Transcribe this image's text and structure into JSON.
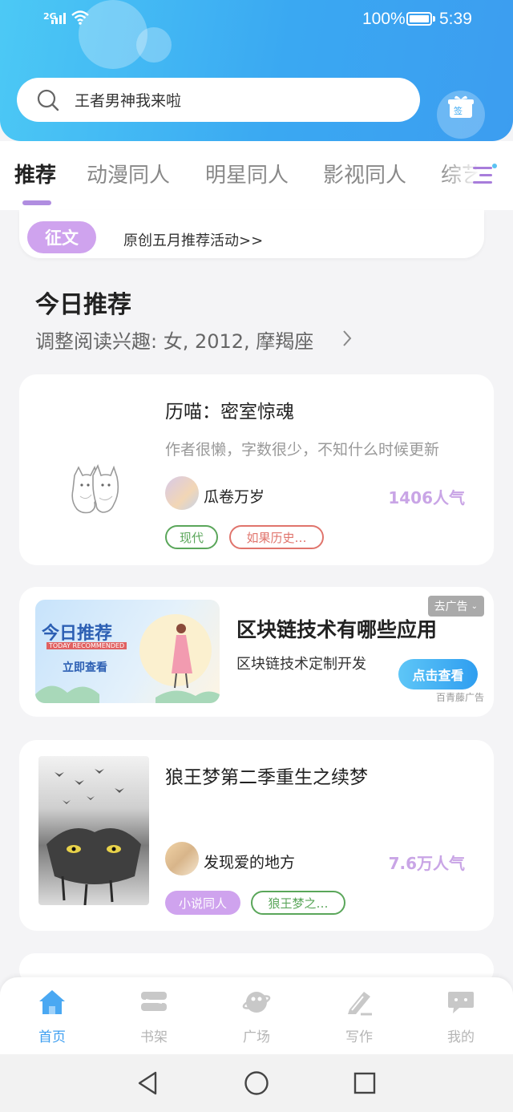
{
  "status_bar": {
    "signal": "2G",
    "battery": "100%",
    "time": "5:39"
  },
  "search": {
    "placeholder": "王者男神我来啦"
  },
  "checkin": {
    "label": "签"
  },
  "tabs": [
    {
      "label": "推荐",
      "active": true
    },
    {
      "label": "动漫同人"
    },
    {
      "label": "明星同人"
    },
    {
      "label": "影视同人"
    },
    {
      "label": "综艺"
    }
  ],
  "notice": {
    "badge": "征文",
    "text": "原创五月推荐活动>>"
  },
  "section": {
    "title": "今日推荐",
    "subtitle": "调整阅读兴趣: 女, 2012, 摩羯座"
  },
  "books": [
    {
      "title": "历喵：密室惊魂",
      "desc": "作者很懒，字数很少，不知什么时候更新",
      "author": "瓜卷万岁",
      "popularity": "1406人气",
      "tags": [
        {
          "label": "现代",
          "color": "#5aa65a"
        },
        {
          "label": "如果历史…",
          "color": "#e0746c"
        }
      ]
    },
    {
      "title": "狼王梦第二季重生之续梦",
      "desc": "",
      "author": "发现爱的地方",
      "popularity": "7.6万人气",
      "tags": [
        {
          "label": "小说同人",
          "filled": true,
          "color": "#cfa3ee"
        },
        {
          "label": "狼王梦之…",
          "color": "#5aa65a"
        }
      ]
    }
  ],
  "ad": {
    "image_title": "今日推荐",
    "image_en": "TODAY RECOMMENDED",
    "image_cta": "立即查看",
    "title": "区块链技术有哪些应用",
    "desc": "区块链技术定制开发",
    "close_label": "去广告",
    "button": "点击查看",
    "source": "百青藤广告"
  },
  "bottom_nav": [
    {
      "label": "首页",
      "icon": "home-icon",
      "active": true
    },
    {
      "label": "书架",
      "icon": "bookshelf-icon"
    },
    {
      "label": "广场",
      "icon": "planet-icon"
    },
    {
      "label": "写作",
      "icon": "pen-icon"
    },
    {
      "label": "我的",
      "icon": "chat-bubble-icon"
    }
  ],
  "colors": {
    "header": "#3aa8f2",
    "accent": "#b08de0",
    "nav_active": "#3f9ff0"
  }
}
